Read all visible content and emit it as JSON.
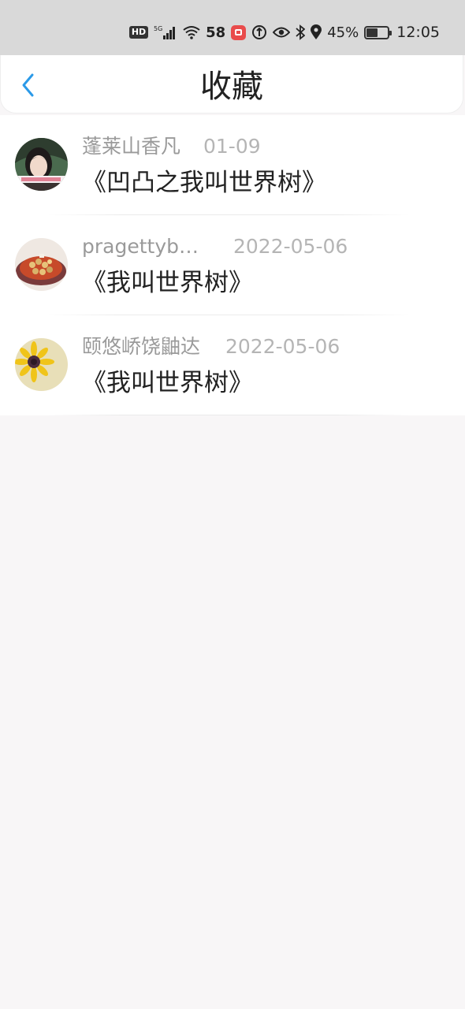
{
  "status_bar": {
    "hd": "HD",
    "network_type": "5G",
    "net_speed": "58",
    "battery_percent": "45%",
    "battery_level": 0.45,
    "time": "12:05",
    "icons": [
      "hd-icon",
      "signal-icon",
      "wifi-icon",
      "app-badge-icon",
      "data-saver-icon",
      "eye-icon",
      "bluetooth-icon",
      "location-icon",
      "battery-icon"
    ]
  },
  "header": {
    "title": "收藏",
    "back_icon": "chevron-left-icon"
  },
  "colors": {
    "accent": "#2b9ae8",
    "title_text": "#222222",
    "meta_text": "#9a9a9a",
    "date_text": "#b5b5b5",
    "page_background": "#f8f6f7"
  },
  "favorites": [
    {
      "username": "蓬莱山香凡",
      "date": "01-09",
      "book_title": "《凹凸之我叫世界树》",
      "avatar": "avatar-girl-photo"
    },
    {
      "username": "pragettyb…",
      "date": "2022-05-06",
      "book_title": "《我叫世界树》",
      "avatar": "avatar-food-photo"
    },
    {
      "username": "颐悠峤饶鼬达",
      "date": "2022-05-06",
      "book_title": "《我叫世界树》",
      "avatar": "avatar-sunflower-photo"
    }
  ]
}
